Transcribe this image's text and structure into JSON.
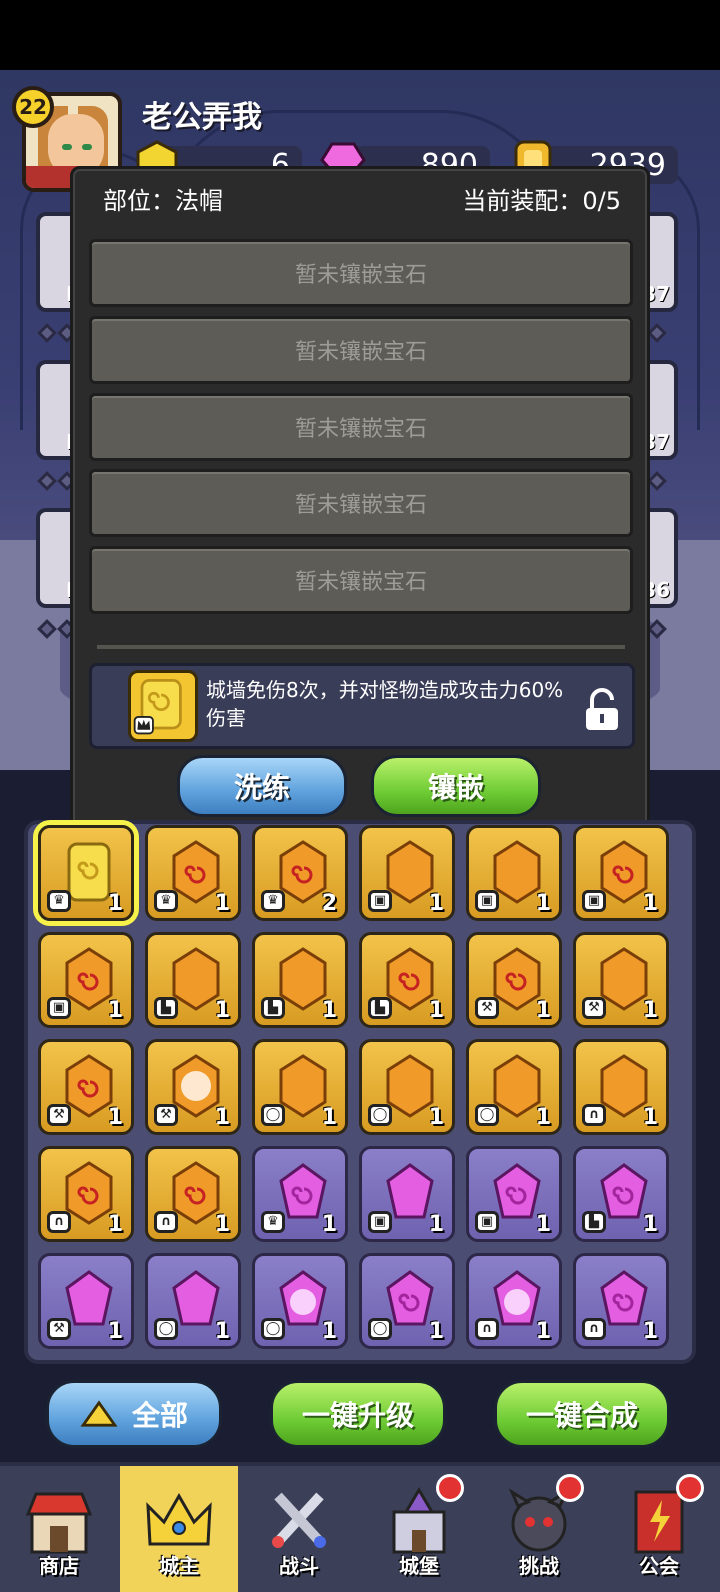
{
  "player": {
    "level": "22",
    "name": "老公弄我"
  },
  "resources": [
    {
      "icon": "gold-gem-icon",
      "value": "6"
    },
    {
      "icon": "pink-crystal-icon",
      "value": "890"
    },
    {
      "icon": "coin-icon",
      "value": "2939"
    }
  ],
  "side_slots": {
    "left_labels": [
      "L",
      "L",
      "L"
    ],
    "right_levels": [
      "37",
      "37",
      "36"
    ]
  },
  "modal": {
    "position_label": "部位：法帽",
    "equip_status": "当前装配：0/5",
    "empty_slot_text": [
      "暂未镶嵌宝石",
      "暂未镶嵌宝石",
      "暂未镶嵌宝石",
      "暂未镶嵌宝石",
      "暂未镶嵌宝石"
    ],
    "effect_text": "城墙免伤8次，并对怪物造成攻击力60%伤害",
    "wash_button": "洗练",
    "inlay_button": "镶嵌"
  },
  "gems": [
    {
      "color": "yellow",
      "type": "crown",
      "count": "1",
      "selected": true
    },
    {
      "color": "orange-swirl",
      "type": "crown",
      "count": "1"
    },
    {
      "color": "orange-swirl",
      "type": "crown",
      "count": "2"
    },
    {
      "color": "orange",
      "type": "armor",
      "count": "1"
    },
    {
      "color": "orange",
      "type": "armor",
      "count": "1"
    },
    {
      "color": "orange-swirl",
      "type": "armor",
      "count": "1"
    },
    {
      "color": "orange-swirl",
      "type": "armor",
      "count": "1"
    },
    {
      "color": "orange",
      "type": "boot",
      "count": "1"
    },
    {
      "color": "orange",
      "type": "boot",
      "count": "1"
    },
    {
      "color": "orange-swirl",
      "type": "boot",
      "count": "1"
    },
    {
      "color": "orange-swirl",
      "type": "staff",
      "count": "1"
    },
    {
      "color": "orange",
      "type": "staff",
      "count": "1"
    },
    {
      "color": "orange-swirl",
      "type": "staff",
      "count": "1"
    },
    {
      "color": "orange-burst",
      "type": "staff",
      "count": "1"
    },
    {
      "color": "orange",
      "type": "ring",
      "count": "1"
    },
    {
      "color": "orange",
      "type": "ring",
      "count": "1"
    },
    {
      "color": "orange",
      "type": "ring",
      "count": "1"
    },
    {
      "color": "orange",
      "type": "necklace",
      "count": "1"
    },
    {
      "color": "orange-swirl",
      "type": "necklace",
      "count": "1"
    },
    {
      "color": "orange-swirl",
      "type": "necklace",
      "count": "1"
    },
    {
      "color": "purple-swirl",
      "type": "crown",
      "count": "1"
    },
    {
      "color": "purple",
      "type": "armor",
      "count": "1"
    },
    {
      "color": "purple-swirl",
      "type": "armor",
      "count": "1"
    },
    {
      "color": "purple-swirl",
      "type": "boot",
      "count": "1"
    },
    {
      "color": "purple",
      "type": "staff",
      "count": "1"
    },
    {
      "color": "purple",
      "type": "ring",
      "count": "1"
    },
    {
      "color": "purple-burst",
      "type": "ring",
      "count": "1"
    },
    {
      "color": "purple-swirl",
      "type": "ring",
      "count": "1"
    },
    {
      "color": "purple-burst",
      "type": "necklace",
      "count": "1"
    },
    {
      "color": "purple-swirl",
      "type": "necklace",
      "count": "1"
    }
  ],
  "actions": {
    "filter_all": "全部",
    "upgrade_all": "一键升级",
    "combine_all": "一键合成"
  },
  "nav": [
    {
      "label": "商店",
      "icon": "shop-icon",
      "active": false,
      "badge": false
    },
    {
      "label": "城主",
      "icon": "crown-icon",
      "active": true,
      "badge": false
    },
    {
      "label": "战斗",
      "icon": "swords-icon",
      "active": false,
      "badge": false
    },
    {
      "label": "城堡",
      "icon": "castle-icon",
      "active": false,
      "badge": true
    },
    {
      "label": "挑战",
      "icon": "demon-icon",
      "active": false,
      "badge": true
    },
    {
      "label": "公会",
      "icon": "guild-banner-icon",
      "active": false,
      "badge": true
    }
  ]
}
